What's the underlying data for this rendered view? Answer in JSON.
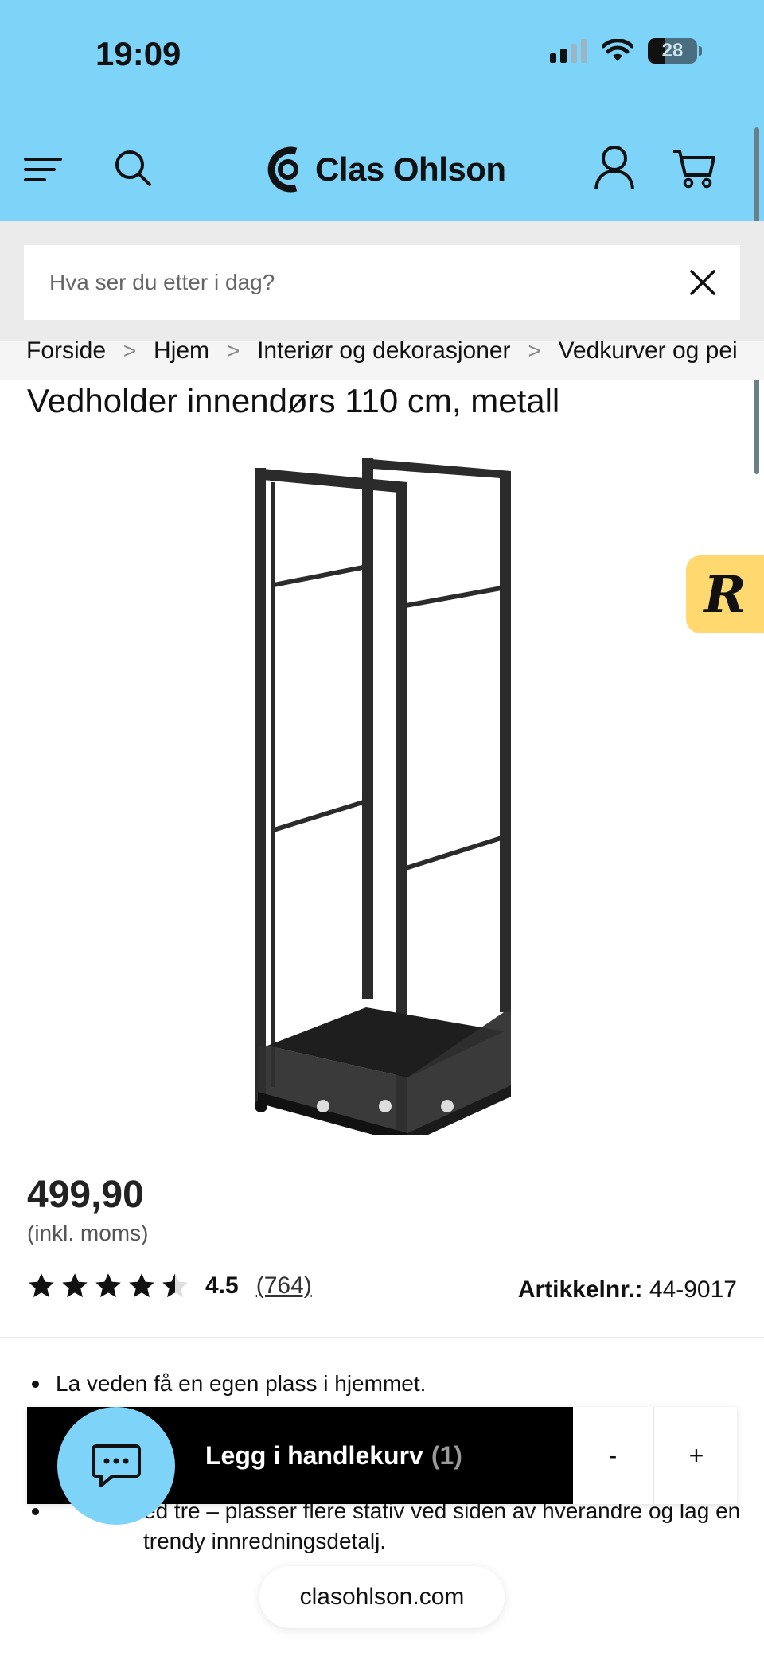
{
  "status_bar": {
    "time": "19:09",
    "battery": "28",
    "icons": [
      "signal-icon",
      "wifi-icon",
      "battery-icon"
    ]
  },
  "header": {
    "brand": "Clas Ohlson",
    "icons": [
      "menu-icon",
      "search-icon",
      "logo-icon",
      "account-icon",
      "cart-icon"
    ],
    "background": "#7dd3f8"
  },
  "search": {
    "placeholder": "Hva ser du etter i dag?"
  },
  "breadcrumb": {
    "items": [
      "Forside",
      "Hjem",
      "Interiør og dekorasjoner",
      "Vedkurver og pei"
    ]
  },
  "product": {
    "title": "Vedholder innendørs 110 cm, metall",
    "image_count": 4,
    "active_image": 1,
    "price": "499,90",
    "vat_note": "(inkl. moms)",
    "rating": "4.5",
    "rating_count": "(764)",
    "article_label": "Artikkelnr.:",
    "article_number": "44-9017",
    "bullets": [
      "La veden få en egen plass i hjemmet.",
      "ed tre – plasser flere stativ ved siden av hverandre og lag en trendy innredningsdetalj."
    ]
  },
  "cart_bar": {
    "add_label": "Legg i handlekurv",
    "quantity": "(1)",
    "minus": "-",
    "plus": "+"
  },
  "review_badge": {
    "letter": "R",
    "color": "#ffd970"
  },
  "browser": {
    "url": "clasohlson.com"
  }
}
